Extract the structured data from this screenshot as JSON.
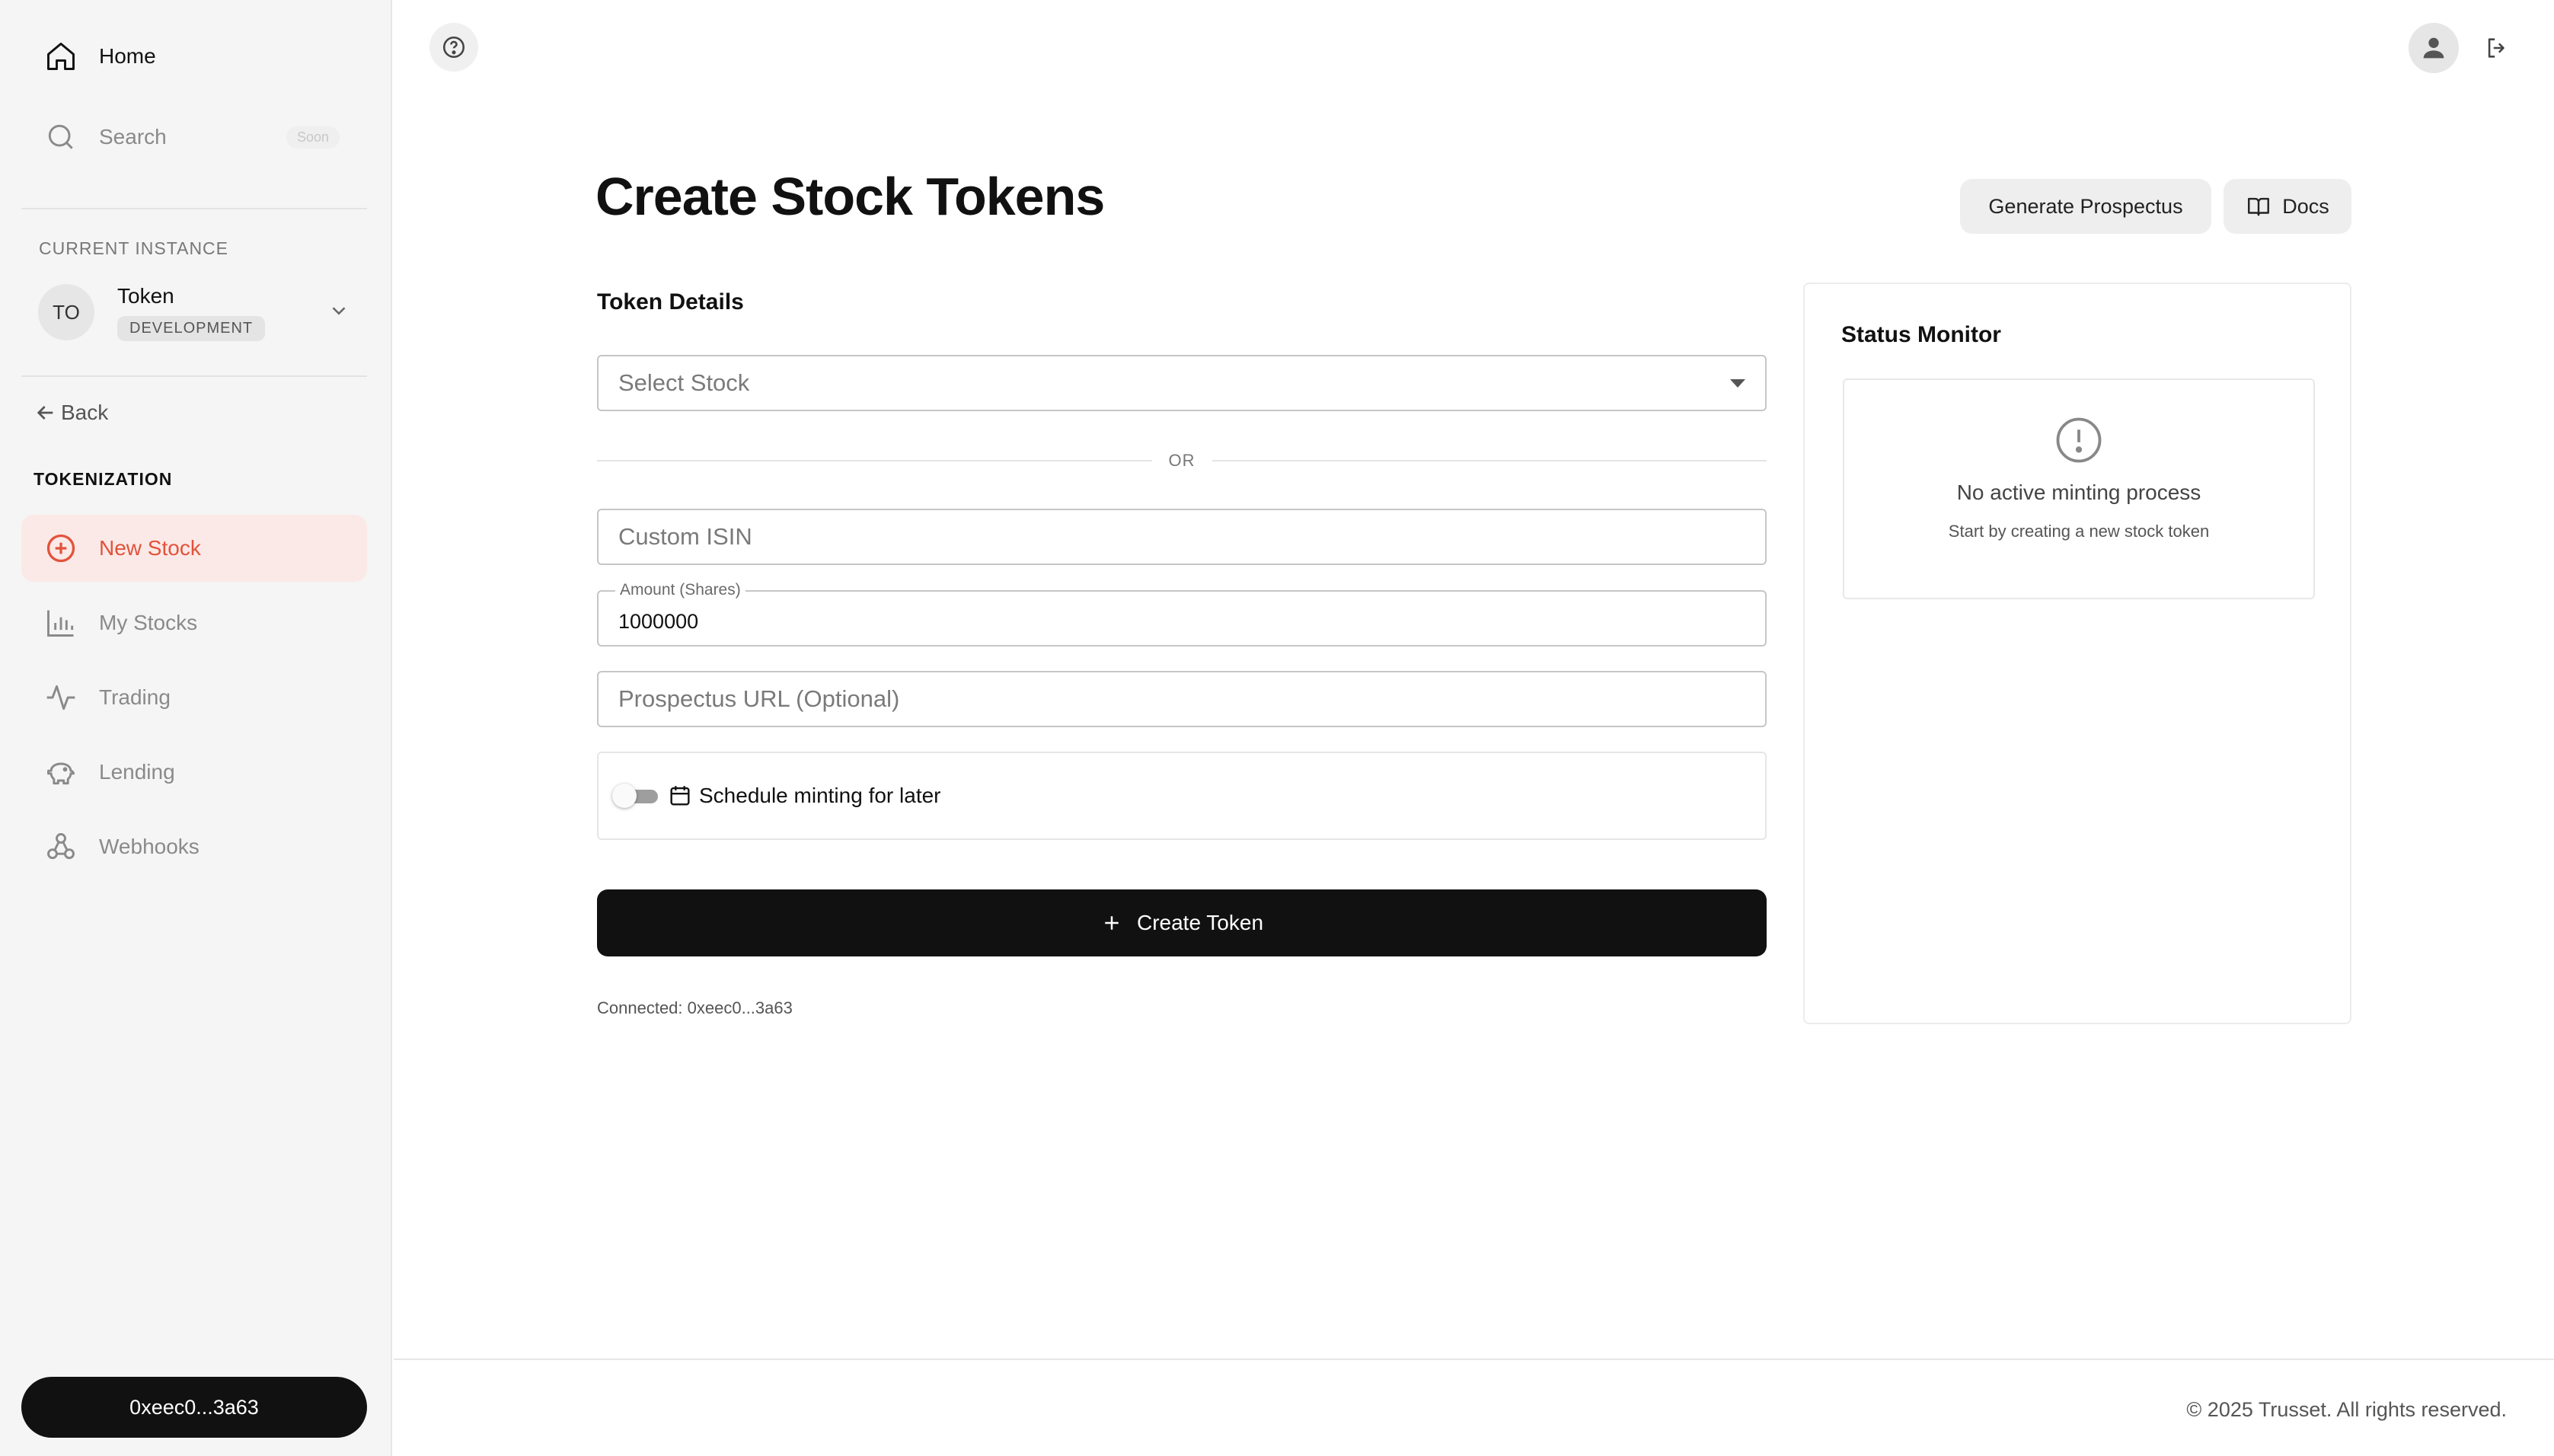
{
  "sidebar": {
    "home_label": "Home",
    "search_label": "Search",
    "search_badge": "Soon",
    "current_instance_title": "CURRENT INSTANCE",
    "instance": {
      "initials": "TO",
      "name": "Token",
      "env": "DEVELOPMENT"
    },
    "back_label": "Back",
    "section_title": "TOKENIZATION",
    "items": [
      {
        "label": "New Stock",
        "icon": "plus-circle-icon",
        "active": true
      },
      {
        "label": "My Stocks",
        "icon": "bar-chart-icon",
        "active": false
      },
      {
        "label": "Trading",
        "icon": "activity-icon",
        "active": false
      },
      {
        "label": "Lending",
        "icon": "piggy-bank-icon",
        "active": false
      },
      {
        "label": "Webhooks",
        "icon": "webhook-icon",
        "active": false
      }
    ],
    "wallet_label": "0xeec0...3a63"
  },
  "header": {
    "help_icon": "help-circle-icon",
    "user_icon": "user-icon",
    "logout_icon": "logout-icon"
  },
  "main": {
    "title": "Create Stock Tokens",
    "generate_prospectus_label": "Generate Prospectus",
    "docs_label": "Docs",
    "token_details_title": "Token Details",
    "select_stock_placeholder": "Select Stock",
    "or_label": "OR",
    "custom_isin_placeholder": "Custom ISIN",
    "amount_label": "Amount (Shares)",
    "amount_value": "1000000",
    "prospectus_url_placeholder": "Prospectus URL (Optional)",
    "schedule_label": "Schedule minting for later",
    "schedule_enabled": false,
    "create_button_label": "Create Token",
    "connected_text": "Connected: 0xeec0...3a63"
  },
  "status_monitor": {
    "title": "Status Monitor",
    "message": "No active minting process",
    "sub_message": "Start by creating a new stock token"
  },
  "footer": {
    "copyright": "© 2025 Trusset. All rights reserved."
  },
  "colors": {
    "accent": "#e2533b",
    "active_bg": "#fbe9e7",
    "primary_button": "#111111",
    "sidebar_bg": "#f5f5f5"
  }
}
